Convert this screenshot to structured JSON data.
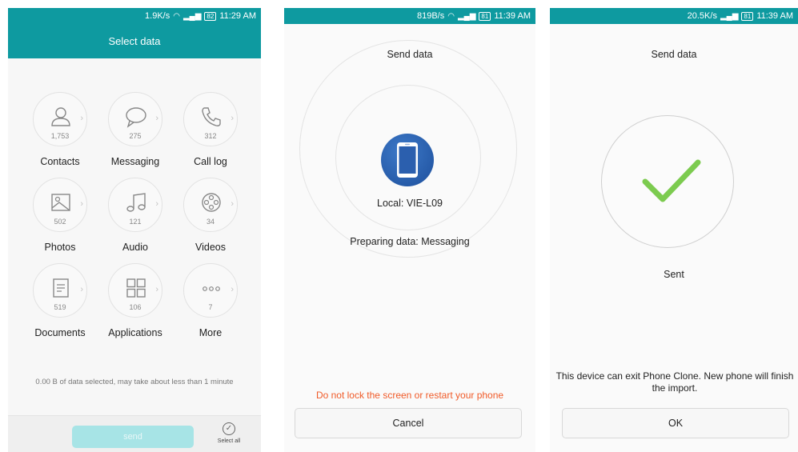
{
  "screen1": {
    "status": {
      "speed": "1.9K/s",
      "battery": "82",
      "time": "11:29 AM"
    },
    "title": "Select data",
    "categories": [
      {
        "label": "Contacts",
        "count": "1,753",
        "icon": "contact-icon"
      },
      {
        "label": "Messaging",
        "count": "275",
        "icon": "message-icon"
      },
      {
        "label": "Call log",
        "count": "312",
        "icon": "phone-call-icon"
      },
      {
        "label": "Photos",
        "count": "502",
        "icon": "photo-icon"
      },
      {
        "label": "Audio",
        "count": "121",
        "icon": "music-note-icon"
      },
      {
        "label": "Videos",
        "count": "34",
        "icon": "film-reel-icon"
      },
      {
        "label": "Documents",
        "count": "519",
        "icon": "document-icon"
      },
      {
        "label": "Applications",
        "count": "106",
        "icon": "apps-grid-icon"
      },
      {
        "label": "More",
        "count": "7",
        "icon": "more-dots-icon"
      }
    ],
    "estimate": "0.00 B of data selected, may take about less than 1 minute",
    "send_label": "send",
    "select_all_label": "Select all"
  },
  "screen2": {
    "status": {
      "speed": "819B/s",
      "battery": "81",
      "time": "11:39 AM"
    },
    "title": "Send data",
    "local_device": "Local: VIE-L09",
    "progress": "Preparing data: Messaging",
    "warning": "Do not lock the screen or restart your phone",
    "cancel_label": "Cancel"
  },
  "screen3": {
    "status": {
      "speed": "20.5K/s",
      "battery": "81",
      "time": "11:39 AM"
    },
    "title": "Send data",
    "result": "Sent",
    "message": "This device can exit Phone Clone. New phone will finish the import.",
    "ok_label": "OK"
  },
  "colors": {
    "teal": "#0e9aa0",
    "warning": "#f05a28",
    "check": "#7ccb4f",
    "phone_badge": "#2a60b0"
  }
}
